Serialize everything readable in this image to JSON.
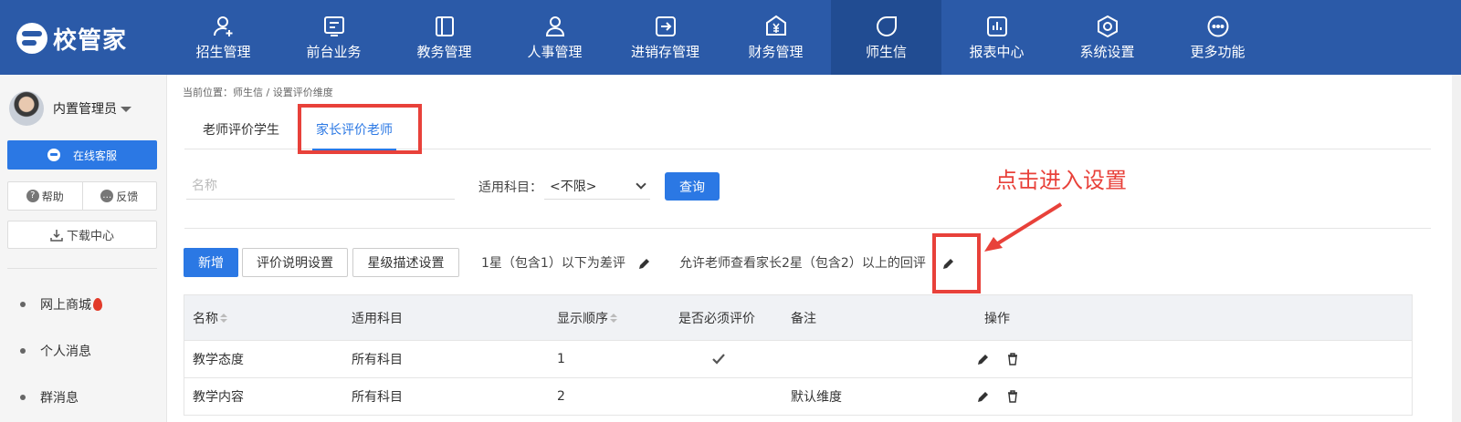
{
  "app": {
    "logo_text": "校管家"
  },
  "nav": {
    "items": [
      {
        "label": "招生管理",
        "icon": "user-plus-icon"
      },
      {
        "label": "前台业务",
        "icon": "desk-icon"
      },
      {
        "label": "教务管理",
        "icon": "book-icon"
      },
      {
        "label": "人事管理",
        "icon": "person-icon"
      },
      {
        "label": "进销存管理",
        "icon": "inventory-icon"
      },
      {
        "label": "财务管理",
        "icon": "yuan-icon"
      },
      {
        "label": "师生信",
        "icon": "chat-icon"
      },
      {
        "label": "报表中心",
        "icon": "report-icon"
      },
      {
        "label": "系统设置",
        "icon": "settings-icon"
      },
      {
        "label": "更多功能",
        "icon": "more-icon"
      }
    ],
    "active_index": 6
  },
  "sidebar": {
    "user_name": "内置管理员",
    "service_label": "在线客服",
    "help_label": "帮助",
    "feedback_label": "反馈",
    "download_label": "下载中心",
    "menu": [
      "网上商城",
      "个人消息",
      "群消息"
    ]
  },
  "breadcrumb": "当前位置：师生信 / 设置评价维度",
  "tabs": [
    "老师评价学生",
    "家长评价老师"
  ],
  "active_tab": 1,
  "filter": {
    "name_placeholder": "名称",
    "subject_label": "适用科目：",
    "subject_value": "<不限>",
    "query_label": "查询"
  },
  "toolbar": {
    "add_label": "新增",
    "desc_settings_label": "评价说明设置",
    "star_desc_label": "星级描述设置",
    "bad_review_rule": "1星（包含1）以下为差评",
    "teacher_view_rule": "允许老师查看家长2星（包含2）以上的回评"
  },
  "annotation": {
    "text": "点击进入设置",
    "color": "#e8413a"
  },
  "table": {
    "columns": [
      "名称",
      "适用科目",
      "显示顺序",
      "是否必须评价",
      "备注",
      "操作"
    ],
    "rows": [
      {
        "name": "教学态度",
        "subject": "所有科目",
        "order": "1",
        "required": true,
        "note": ""
      },
      {
        "name": "教学内容",
        "subject": "所有科目",
        "order": "2",
        "required": false,
        "note": "默认维度"
      }
    ]
  },
  "colors": {
    "nav_bg": "#2b5aa8",
    "accent": "#2b78e4",
    "annotation_red": "#e8413a"
  }
}
